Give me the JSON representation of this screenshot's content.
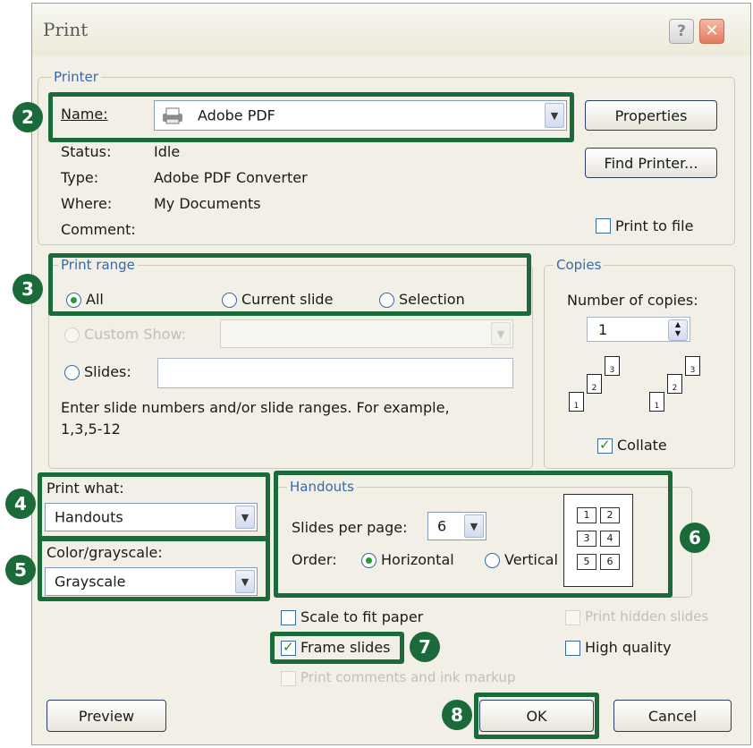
{
  "dialog": {
    "title": "Print"
  },
  "printer": {
    "legend": "Printer",
    "name_label": "Name:",
    "name_value": "Adobe PDF",
    "status_label": "Status:",
    "status_value": "Idle",
    "type_label": "Type:",
    "type_value": "Adobe PDF Converter",
    "where_label": "Where:",
    "where_value": "My Documents",
    "comment_label": "Comment:",
    "properties_button": "Properties",
    "find_printer_button": "Find Printer...",
    "print_to_file_label": "Print to file",
    "print_to_file_checked": false
  },
  "print_range": {
    "legend": "Print range",
    "all_label": "All",
    "current_slide_label": "Current slide",
    "selection_label": "Selection",
    "custom_show_label": "Custom Show:",
    "slides_label": "Slides:",
    "slides_value": "",
    "help_text": "Enter slide numbers and/or slide ranges. For example,",
    "help_example": "1,3,5-12",
    "selected": "All"
  },
  "copies": {
    "legend": "Copies",
    "number_label": "Number of copies:",
    "number_value": "1",
    "collate_label": "Collate",
    "collate_checked": true,
    "page_numbers": [
      "1",
      "2",
      "3"
    ]
  },
  "print_what": {
    "label": "Print what:",
    "value": "Handouts"
  },
  "color": {
    "label": "Color/grayscale:",
    "value": "Grayscale"
  },
  "handouts": {
    "legend": "Handouts",
    "slides_per_page_label": "Slides per page:",
    "slides_per_page_value": "6",
    "order_label": "Order:",
    "horizontal_label": "Horizontal",
    "vertical_label": "Vertical",
    "order_selected": "Horizontal",
    "preview_cells": [
      "1",
      "2",
      "3",
      "4",
      "5",
      "6"
    ]
  },
  "options": {
    "scale_to_fit": "Scale to fit paper",
    "frame_slides": "Frame slides",
    "print_comments": "Print comments and ink markup",
    "print_hidden": "Print hidden slides",
    "high_quality": "High quality",
    "frame_slides_checked": true
  },
  "footer": {
    "preview_button": "Preview",
    "ok_button": "OK",
    "cancel_button": "Cancel"
  },
  "callouts": [
    "2",
    "3",
    "4",
    "5",
    "6",
    "7",
    "8"
  ],
  "colors": {
    "callout": "#1a6a3a",
    "legend_text": "#3a68a8",
    "dialog_bg": "#f1efe6"
  }
}
